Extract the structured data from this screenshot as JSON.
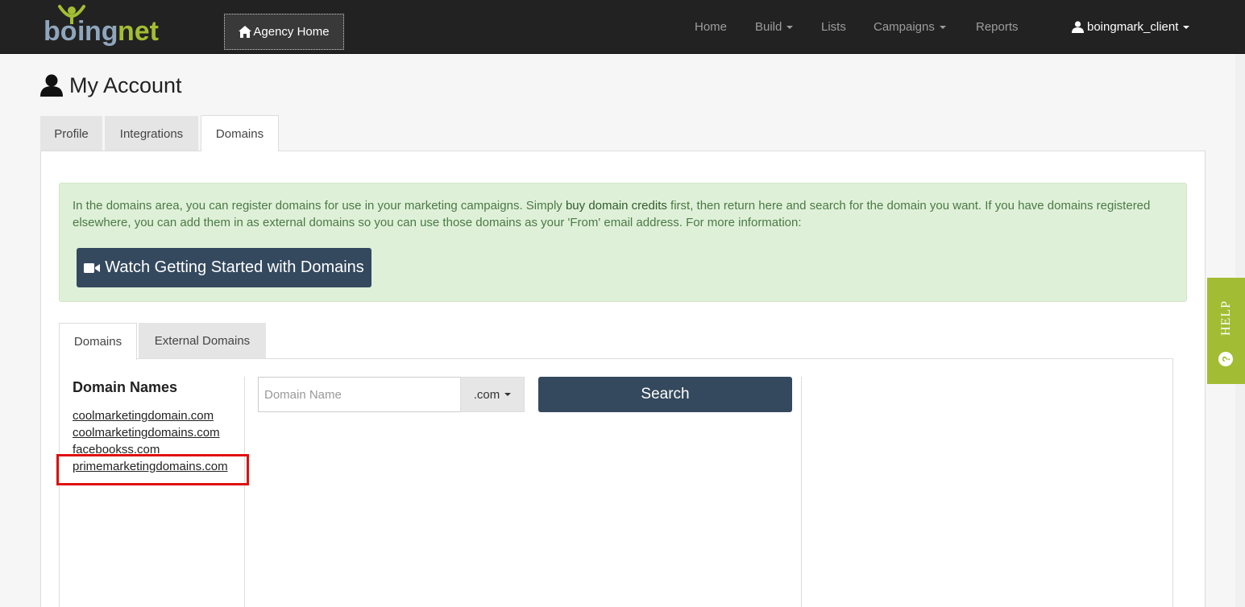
{
  "topnav": {
    "logo_text": "boingnet",
    "agency_home": "Agency Home",
    "links": {
      "home": "Home",
      "build": "Build",
      "lists": "Lists",
      "campaigns": "Campaigns",
      "reports": "Reports"
    },
    "user": "boingmark_client"
  },
  "page": {
    "title": "My Account",
    "tabs": {
      "profile": "Profile",
      "integrations": "Integrations",
      "domains": "Domains"
    },
    "active_tab": "Domains"
  },
  "alert": {
    "text_before": "In the domains area, you can register domains for use in your marketing campaigns. Simply ",
    "text_highlight": "buy domain credits",
    "text_after": " first, then return here and search for the domain you want. If you have domains registered elsewhere, you can add them in as external domains so you can use those domains as your 'From' email address. For more information:",
    "button": "Watch Getting Started with Domains"
  },
  "domains": {
    "tabs": {
      "domains": "Domains",
      "external": "External Domains"
    },
    "active_tab": "Domains",
    "heading": "Domain Names",
    "list": [
      "coolmarketingdomain.com",
      "coolmarketingdomains.com",
      "facebookss.com",
      "primemarketingdomains.com"
    ],
    "highlighted_item": "primemarketingdomains.com",
    "search": {
      "placeholder": "Domain Name",
      "value": "",
      "tld": ".com",
      "button": "Search"
    }
  },
  "help": {
    "label": "HELP",
    "icon_glyph": "?"
  },
  "colors": {
    "topbar": "#222222",
    "button_dark": "#34495e",
    "alert_bg": "#dff0d8",
    "help_green": "#a2bd33",
    "highlight_red": "#e01010"
  }
}
